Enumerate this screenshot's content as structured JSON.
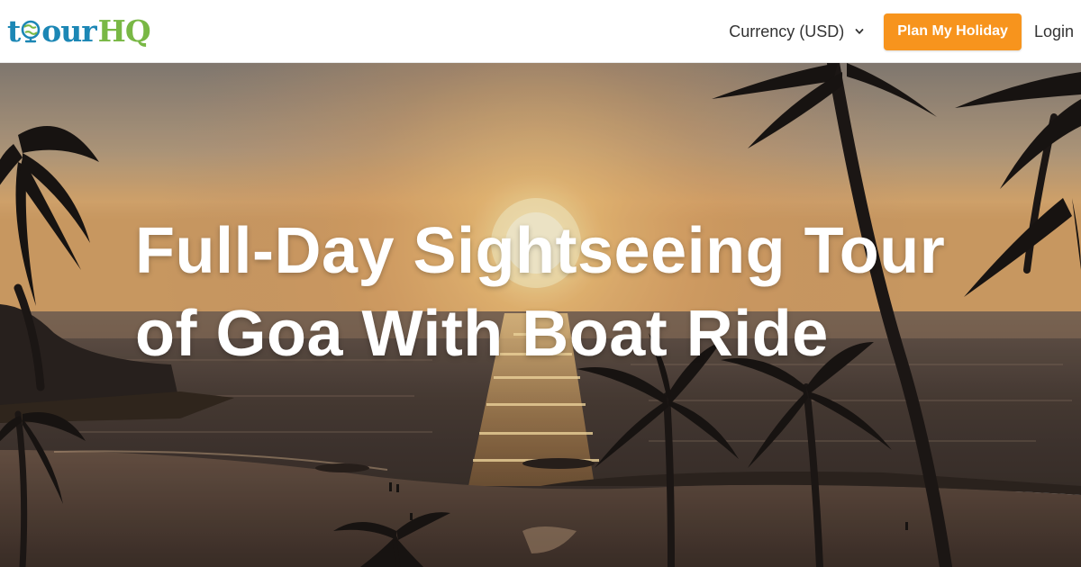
{
  "header": {
    "logo": {
      "text_t": "t",
      "text_our": "our",
      "text_hq": "HQ",
      "icon": "globe-icon"
    },
    "currency": {
      "label": "Currency (USD)",
      "icon": "chevron-down-icon"
    },
    "plan_button": "Plan My Holiday",
    "login": "Login"
  },
  "hero": {
    "title_line1": "Full-Day Sightseeing Tour",
    "title_line2": "of Goa With Boat Ride"
  },
  "colors": {
    "brand_blue": "#1c87b5",
    "brand_green": "#79b845",
    "accent_orange": "#f7941d"
  }
}
